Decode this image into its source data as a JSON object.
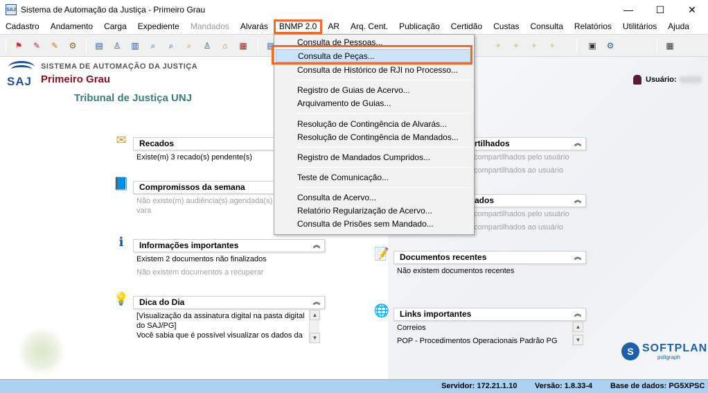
{
  "window": {
    "title": "Sistema de Automação da Justiça - Primeiro Grau",
    "icon_text": "SAJ",
    "minimize": "—",
    "maximize": "☐",
    "close": "✕"
  },
  "menubar": {
    "items": [
      {
        "label": "Cadastro",
        "disabled": false
      },
      {
        "label": "Andamento",
        "disabled": false
      },
      {
        "label": "Carga",
        "disabled": false
      },
      {
        "label": "Expediente",
        "disabled": false
      },
      {
        "label": "Mandados",
        "disabled": true
      },
      {
        "label": "Alvarás",
        "disabled": false
      },
      {
        "label": "BNMP 2.0",
        "disabled": false,
        "active": true
      },
      {
        "label": "AR",
        "disabled": false
      },
      {
        "label": "Arq. Cent.",
        "disabled": false
      },
      {
        "label": "Publicação",
        "disabled": false
      },
      {
        "label": "Certidão",
        "disabled": false
      },
      {
        "label": "Custas",
        "disabled": false
      },
      {
        "label": "Consulta",
        "disabled": false
      },
      {
        "label": "Relatórios",
        "disabled": false
      },
      {
        "label": "Utilitários",
        "disabled": false
      },
      {
        "label": "Ajuda",
        "disabled": false
      }
    ]
  },
  "header": {
    "system_name": "SISTEMA DE AUTOMAÇÃO DA JUSTIÇA",
    "logo_text": "SAJ",
    "grau": "Primeiro Grau",
    "tribunal": "Tribunal de Justiça UNJ",
    "user_label": "Usuário:"
  },
  "panels": {
    "recados": {
      "title": "Recados",
      "lines": [
        "Existe(m) 3 recado(s) pendente(s)"
      ]
    },
    "compromissos": {
      "title": "Compromissos da semana",
      "lines": [
        "Não existe(m) audiência(s) agendada(s)",
        "vara"
      ]
    },
    "informacoes": {
      "title": "Informações importantes",
      "lines": [
        "Existem 2 documentos não finalizados",
        "Não existem documentos a recuperar"
      ]
    },
    "dica": {
      "title": "Dica do Dia",
      "lines": [
        "[Visualização da assinatura digital na pasta digital",
        "do SAJ/PG]",
        "Você sabia que é possível visualizar os dados da"
      ]
    },
    "compartilhados1": {
      "title": "rtilhados",
      "lines": [
        "compartilhados pelo usuário",
        "compartilhados ao usuário"
      ]
    },
    "compartilhados2": {
      "title": "ados",
      "lines": [
        "compartilhados pelo usuário",
        "compartilhados ao usuário"
      ]
    },
    "documentos": {
      "title": "Documentos recentes",
      "lines": [
        "Não existem documentos recentes"
      ]
    },
    "links": {
      "title": "Links importantes",
      "lines": [
        "Correios",
        "POP - Procedimentos Operacionais Padrão PG"
      ]
    }
  },
  "dropdown": {
    "items": [
      "Consulta de Pessoas...",
      "Consulta de Peças...",
      "Consulta de Histórico de RJI no Processo...",
      "Registro de Guias de Acervo...",
      "Arquivamento de Guias...",
      "Resolução de Contingência de Alvarás...",
      "Resolução de Contingência de Mandados...",
      "Registro de Mandados Cumpridos...",
      "Teste de Comunicação...",
      "Consulta de Acervo...",
      "Relatório Regularização de Acervo...",
      "Consulta de Prisões sem Mandado..."
    ],
    "highlighted": "Consulta de Peças..."
  },
  "branding": {
    "name": "SOFTPLAN",
    "sub": "poligraph",
    "mark": "S"
  },
  "statusbar": {
    "servidor": "Servidor: 172.21.1.10",
    "versao": "Versão: 1.8.33-4",
    "base": "Base de dados: PG5XPSC"
  },
  "colors": {
    "accent_highlight": "#f06a2c",
    "statusbar": "#a9d2f2",
    "tribunal": "#3a7f80",
    "grau": "#8b1020",
    "saj_blue": "#1f4e9c"
  },
  "icons": {
    "chevron_up": "︽",
    "scroll_up": "▲",
    "scroll_down": "▼",
    "recados": "✉",
    "compromissos": "📘",
    "informacoes": "ℹ",
    "dica": "💡",
    "documentos": "📝",
    "links": "🌐"
  }
}
